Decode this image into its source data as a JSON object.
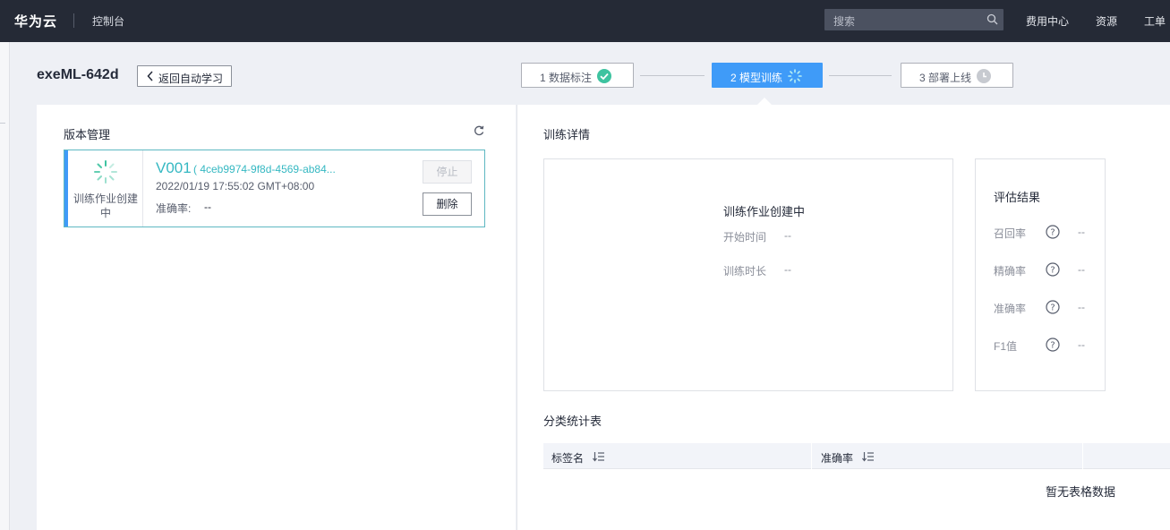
{
  "topbar": {
    "brand": "华为云",
    "console": "控制台",
    "search_placeholder": "搜索",
    "nav": [
      "费用中心",
      "资源",
      "工单"
    ]
  },
  "header": {
    "title": "exeML-642d",
    "back_label": "返回自动学习"
  },
  "steps": [
    {
      "label": "1 数据标注",
      "status": "done"
    },
    {
      "label": "2 模型训练",
      "status": "active"
    },
    {
      "label": "3 部署上线",
      "status": "pending"
    }
  ],
  "version_panel": {
    "title": "版本管理",
    "card": {
      "status_text": "训练作业创建中",
      "version": "V001",
      "job_id": "( 4ceb9974-9f8d-4569-ab84...",
      "time": "2022/01/19 17:55:02 GMT+08:00",
      "accuracy_label": "准确率:",
      "accuracy_value": "--",
      "stop_label": "停止",
      "delete_label": "删除"
    }
  },
  "detail_panel": {
    "title": "训练详情",
    "status": "训练作业创建中",
    "start_time_label": "开始时间",
    "start_time_value": "--",
    "duration_label": "训练时长",
    "duration_value": "--"
  },
  "eval_panel": {
    "title": "评估结果",
    "metrics": [
      {
        "label": "召回率",
        "value": "--"
      },
      {
        "label": "精确率",
        "value": "--"
      },
      {
        "label": "准确率",
        "value": "--"
      },
      {
        "label": "F1值",
        "value": "--"
      }
    ]
  },
  "stats_table": {
    "title": "分类统计表",
    "columns": [
      "标签名",
      "准确率"
    ],
    "empty_text": "暂无表格数据"
  },
  "colors": {
    "topbar": "#252a36",
    "accent": "#3f9bf8",
    "teal": "#35b8c2",
    "success": "#3ec3a0"
  }
}
